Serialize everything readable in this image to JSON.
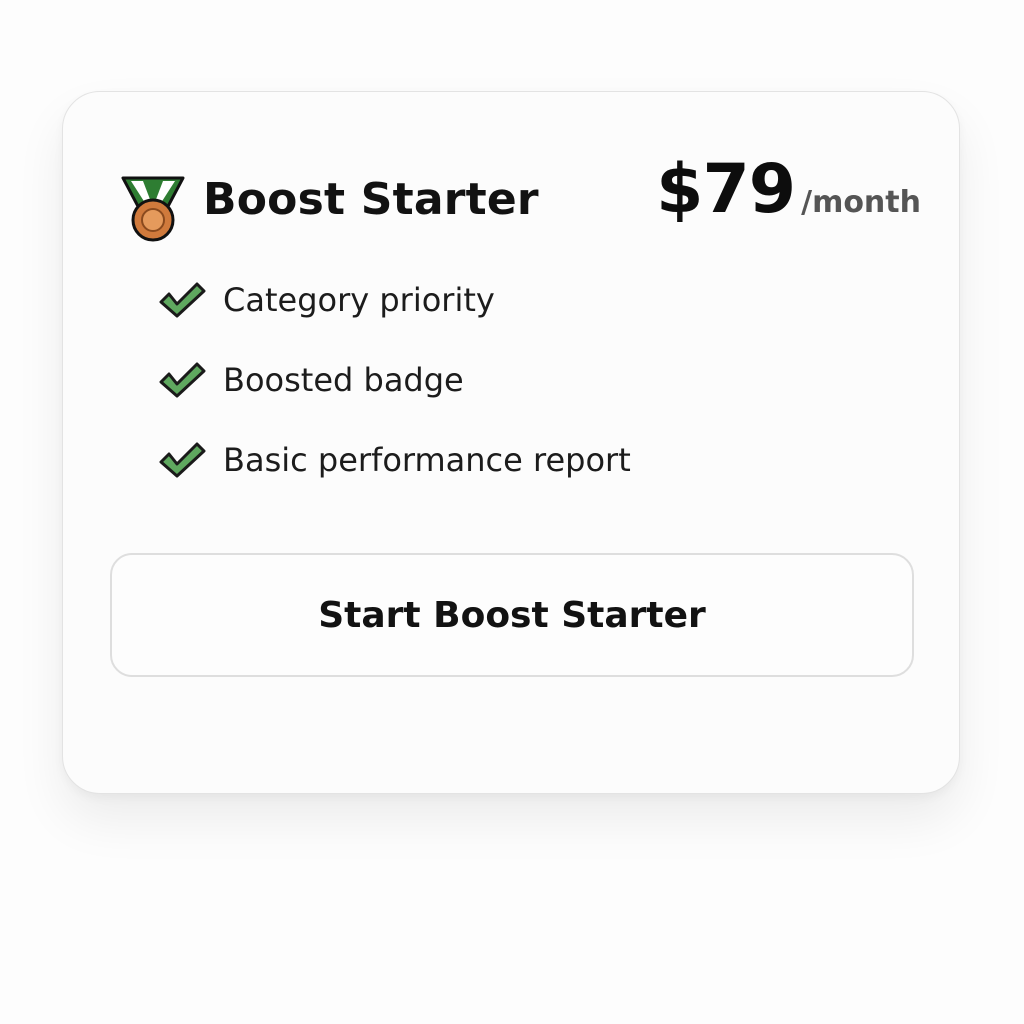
{
  "plan": {
    "icon": "medal-icon",
    "name": "Boost Starter",
    "price": "$79",
    "period": "/month"
  },
  "features": [
    {
      "icon": "check-icon",
      "label": "Category priority"
    },
    {
      "icon": "check-icon",
      "label": "Boosted badge"
    },
    {
      "icon": "check-icon",
      "label": "Basic performance report"
    }
  ],
  "cta": {
    "label": "Start Boost Starter"
  },
  "colors": {
    "check_fill": "#5fa85f",
    "check_outline": "#1a1a1a",
    "ribbon_green": "#2e7d32",
    "medal_bronze": "#d07a3c"
  }
}
